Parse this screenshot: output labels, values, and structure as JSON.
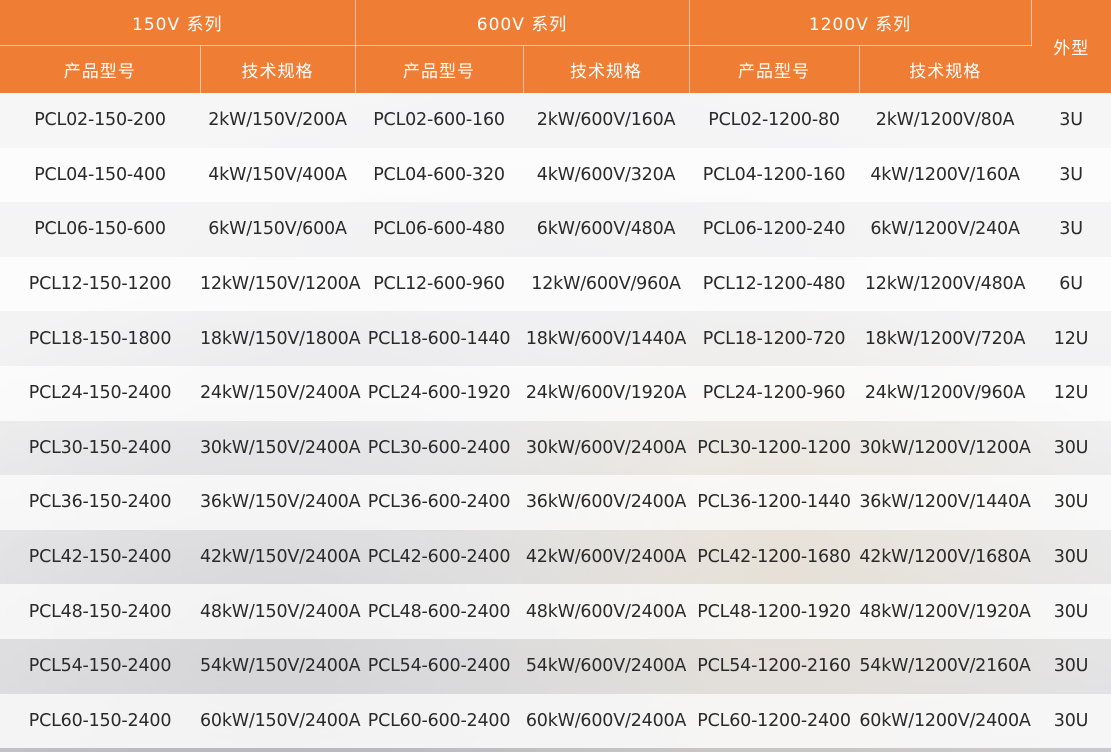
{
  "header": {
    "series": [
      {
        "label": "150V 系列"
      },
      {
        "label": "600V 系列"
      },
      {
        "label": "1200V 系列"
      }
    ],
    "model_label": "产品型号",
    "spec_label": "技术规格",
    "form_label": "外型"
  },
  "colors": {
    "header_orange": "#ef7d34",
    "header_text": "#ffffff",
    "body_text": "#2a2a2a"
  },
  "rows": [
    {
      "m150": "PCL02-150-200",
      "s150": "2kW/150V/200A",
      "m600": "PCL02-600-160",
      "s600": "2kW/600V/160A",
      "m1200": "PCL02-1200-80",
      "s1200": "2kW/1200V/80A",
      "form": "3U"
    },
    {
      "m150": "PCL04-150-400",
      "s150": "4kW/150V/400A",
      "m600": "PCL04-600-320",
      "s600": "4kW/600V/320A",
      "m1200": "PCL04-1200-160",
      "s1200": "4kW/1200V/160A",
      "form": "3U"
    },
    {
      "m150": "PCL06-150-600",
      "s150": "6kW/150V/600A",
      "m600": "PCL06-600-480",
      "s600": "6kW/600V/480A",
      "m1200": "PCL06-1200-240",
      "s1200": "6kW/1200V/240A",
      "form": "3U"
    },
    {
      "m150": "PCL12-150-1200",
      "s150": "12kW/150V/1200A",
      "m600": "PCL12-600-960",
      "s600": "12kW/600V/960A",
      "m1200": "PCL12-1200-480",
      "s1200": "12kW/1200V/480A",
      "form": "6U"
    },
    {
      "m150": "PCL18-150-1800",
      "s150": "18kW/150V/1800A",
      "m600": "PCL18-600-1440",
      "s600": "18kW/600V/1440A",
      "m1200": "PCL18-1200-720",
      "s1200": "18kW/1200V/720A",
      "form": "12U"
    },
    {
      "m150": "PCL24-150-2400",
      "s150": "24kW/150V/2400A",
      "m600": "PCL24-600-1920",
      "s600": "24kW/600V/1920A",
      "m1200": "PCL24-1200-960",
      "s1200": "24kW/1200V/960A",
      "form": "12U"
    },
    {
      "m150": "PCL30-150-2400",
      "s150": "30kW/150V/2400A",
      "m600": "PCL30-600-2400",
      "s600": "30kW/600V/2400A",
      "m1200": "PCL30-1200-1200",
      "s1200": "30kW/1200V/1200A",
      "form": "30U"
    },
    {
      "m150": "PCL36-150-2400",
      "s150": "36kW/150V/2400A",
      "m600": "PCL36-600-2400",
      "s600": "36kW/600V/2400A",
      "m1200": "PCL36-1200-1440",
      "s1200": "36kW/1200V/1440A",
      "form": "30U"
    },
    {
      "m150": "PCL42-150-2400",
      "s150": "42kW/150V/2400A",
      "m600": "PCL42-600-2400",
      "s600": "42kW/600V/2400A",
      "m1200": "PCL42-1200-1680",
      "s1200": "42kW/1200V/1680A",
      "form": "30U"
    },
    {
      "m150": "PCL48-150-2400",
      "s150": "48kW/150V/2400A",
      "m600": "PCL48-600-2400",
      "s600": "48kW/600V/2400A",
      "m1200": "PCL48-1200-1920",
      "s1200": "48kW/1200V/1920A",
      "form": "30U"
    },
    {
      "m150": "PCL54-150-2400",
      "s150": "54kW/150V/2400A",
      "m600": "PCL54-600-2400",
      "s600": "54kW/600V/2400A",
      "m1200": "PCL54-1200-2160",
      "s1200": "54kW/1200V/2160A",
      "form": "30U"
    },
    {
      "m150": "PCL60-150-2400",
      "s150": "60kW/150V/2400A",
      "m600": "PCL60-600-2400",
      "s600": "60kW/600V/2400A",
      "m1200": "PCL60-1200-2400",
      "s1200": "60kW/1200V/2400A",
      "form": "30U"
    }
  ]
}
